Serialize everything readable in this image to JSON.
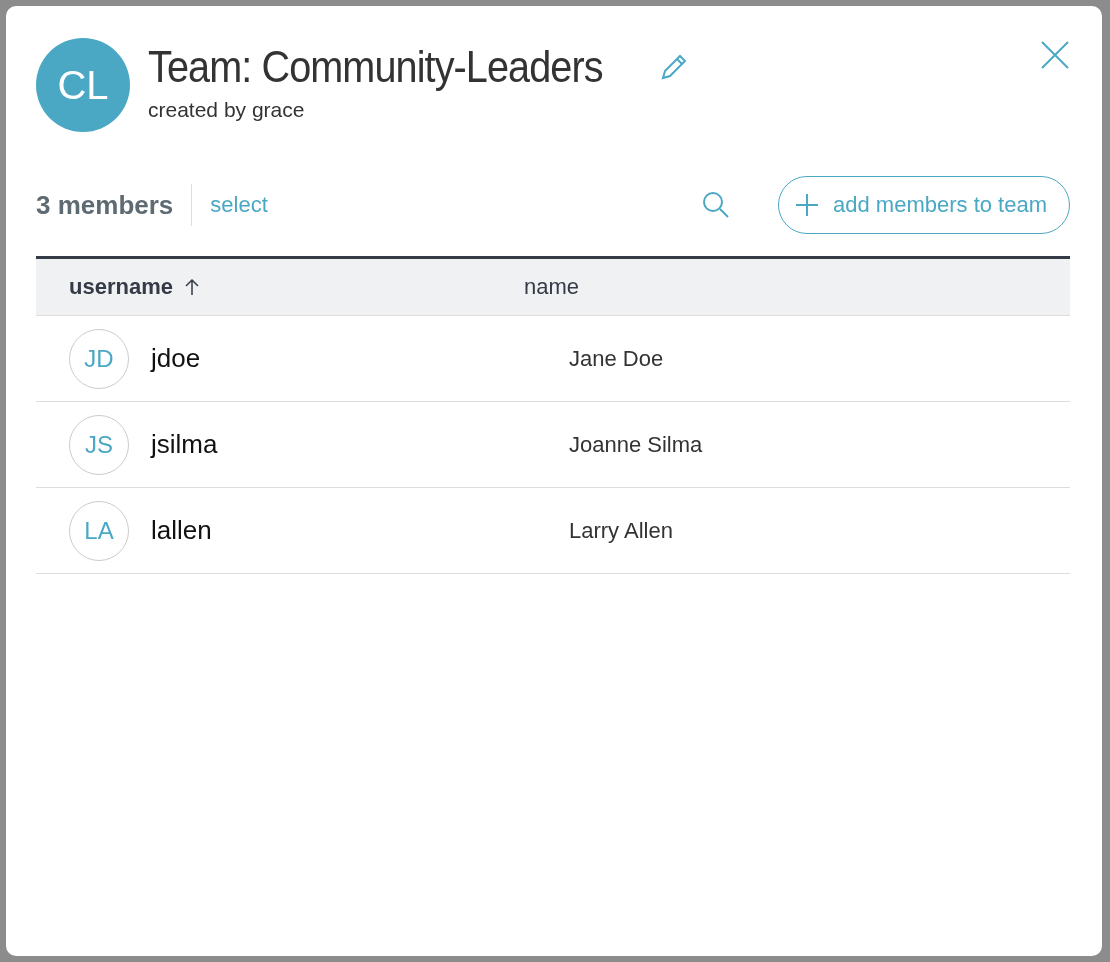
{
  "dialog": {
    "avatar_initials": "CL",
    "title": "Team: Community-Leaders",
    "subtitle": "created by grace"
  },
  "toolbar": {
    "count": "3 members",
    "select_link": "select",
    "add_button": "add members to team"
  },
  "table": {
    "columns": [
      {
        "label": "username",
        "sorted": true
      },
      {
        "label": "name",
        "sorted": false
      }
    ],
    "rows": [
      {
        "initials": "JD",
        "username": "jdoe",
        "name": "Jane Doe"
      },
      {
        "initials": "JS",
        "username": "jsilma",
        "name": "Joanne Silma"
      },
      {
        "initials": "LA",
        "username": "lallen",
        "name": "Larry Allen"
      }
    ]
  }
}
